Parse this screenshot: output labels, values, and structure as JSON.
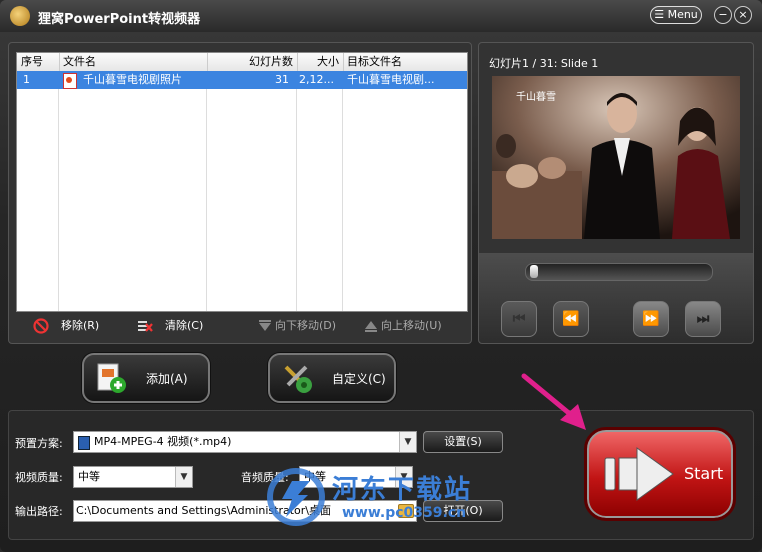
{
  "app": {
    "title": "狸窝PowerPoint转视频器",
    "menu_label": "Menu"
  },
  "table": {
    "headers": [
      "序号",
      "文件名",
      "幻灯片数",
      "大小",
      "目标文件名"
    ],
    "rows": [
      {
        "index": "1",
        "filename": "千山暮雪电视剧照片",
        "slides": "31",
        "size": "2,12...",
        "target": "千山暮雪电视剧..."
      }
    ]
  },
  "list_actions": {
    "remove": "移除(R)",
    "clear": "清除(C)",
    "move_down": "向下移动(D)",
    "move_up": "向上移动(U)"
  },
  "preview": {
    "title": "幻灯片1 / 31: Slide 1",
    "photo_caption": "千山暮雪"
  },
  "buttons": {
    "add": "添加(A)",
    "custom": "自定义(C)",
    "start": "Start",
    "settings": "设置(S)",
    "open": "打开(O)"
  },
  "form": {
    "preset_label": "预置方案:",
    "preset_value": "MP4-MPEG-4 视频(*.mp4)",
    "video_quality_label": "视频质量:",
    "video_quality_value": "中等",
    "audio_quality_label": "音频质量:",
    "audio_quality_value": "中等",
    "output_label": "输出路径:",
    "output_value": "C:\\Documents and Settings\\Administrator\\桌面"
  },
  "watermark": {
    "text": "河东下载站",
    "url": "www.pc0359.cn"
  },
  "colors": {
    "selection": "#3b84e0",
    "start": "#c11414",
    "accent_arrow": "#e0208c"
  }
}
